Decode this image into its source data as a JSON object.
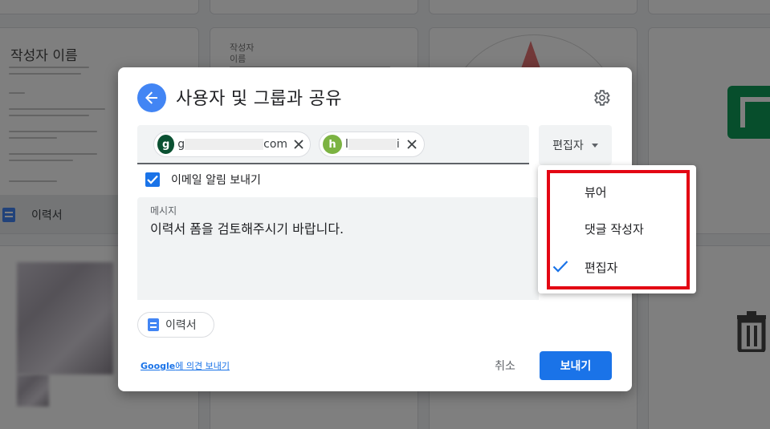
{
  "dialog": {
    "title": "사용자 및 그룹과 공유",
    "recipients": [
      {
        "initial": "g",
        "visible_start": "g",
        "visible_end": "com",
        "avatar_color": "#0b5132"
      },
      {
        "initial": "h",
        "visible_start": "l",
        "visible_end": "i",
        "avatar_color": "#7cb342"
      }
    ],
    "role_button_label": "편집자",
    "notify_label": "이메일 알림 보내기",
    "message_label": "메시지",
    "message_value": "이력서 폼을 검토해주시기 바랍니다.",
    "attachment_label": "이력서",
    "feedback_prefix": "Google",
    "feedback_suffix": "에 의견 보내기",
    "cancel_label": "취소",
    "send_label": "보내기"
  },
  "role_menu": {
    "items": [
      {
        "label": "뷰어",
        "selected": false
      },
      {
        "label": "댓글 작성자",
        "selected": false
      },
      {
        "label": "편집자",
        "selected": true
      }
    ],
    "highlight_color": "#e30613"
  },
  "background": {
    "resume_title": "작성자 이름",
    "resume_title_alt": "작성자\n이름",
    "file_name": "이력서"
  },
  "colors": {
    "primary": "#1a73e8",
    "back_button": "#4285f4",
    "sheets_green": "#0f9d58"
  }
}
